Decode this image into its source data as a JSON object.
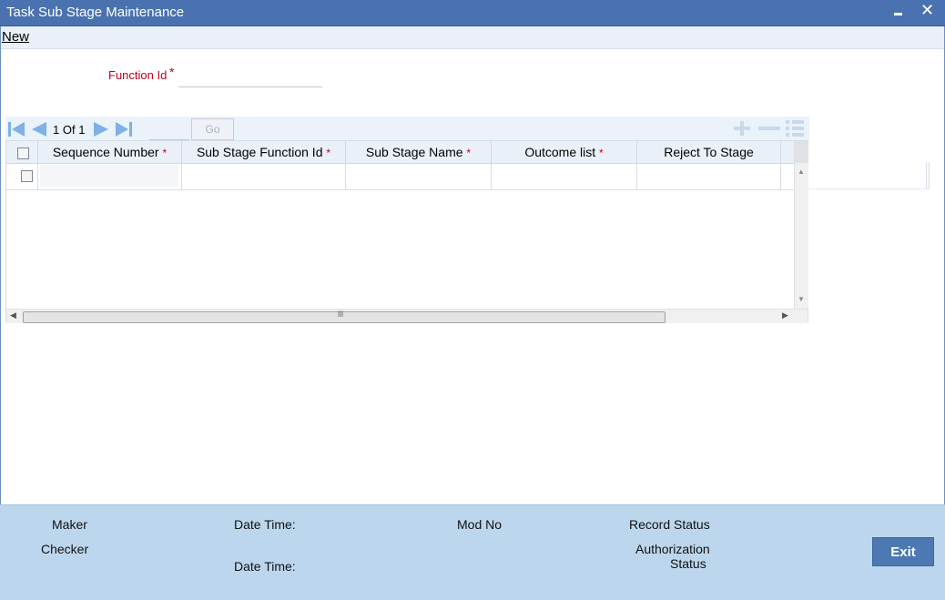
{
  "window": {
    "title": "Task Sub Stage Maintenance",
    "minimize_icon": "minimize-icon",
    "close_icon": "close-icon",
    "close_glyph": "✕"
  },
  "toolbar": {
    "new_label": "New"
  },
  "form": {
    "function_id_label": "Function Id",
    "required_marker": "*",
    "function_id_value": ""
  },
  "grid_toolbar": {
    "page_current": "1",
    "page_of": "Of",
    "page_total": "1",
    "go_label": "Go",
    "icons": [
      "first-page-icon",
      "previous-page-icon",
      "next-page-icon",
      "last-page-icon",
      "add-row-icon",
      "delete-row-icon",
      "single-view-icon"
    ]
  },
  "grid": {
    "columns": [
      {
        "label": "Sequence Number",
        "required": "*"
      },
      {
        "label": "Sub Stage Function Id",
        "required": "*"
      },
      {
        "label": "Sub Stage Name",
        "required": "*"
      },
      {
        "label": "Outcome list",
        "required": "*"
      },
      {
        "label": "Reject To Stage",
        "required": ""
      }
    ],
    "rows": [
      {
        "sequence_number": "",
        "sub_stage_function_id": "",
        "sub_stage_name": "",
        "outcome_list": "",
        "reject_to_stage": ""
      }
    ],
    "hscroll_grip": "lll"
  },
  "footer": {
    "maker_label": "Maker",
    "checker_label": "Checker",
    "date_time_label": "Date Time:",
    "date_time_label_2": "Date Time:",
    "mod_no_label": "Mod No",
    "record_status_label": "Record Status",
    "authorization_label": "Authorization",
    "status_label": "Status",
    "exit_label": "Exit"
  },
  "colors": {
    "title_bar": "#4a72b0",
    "required": "#c0001f",
    "footer_bg": "#bcd7ed",
    "exit_button": "#4d79b3",
    "nav_icon": "#7fb0e6"
  }
}
